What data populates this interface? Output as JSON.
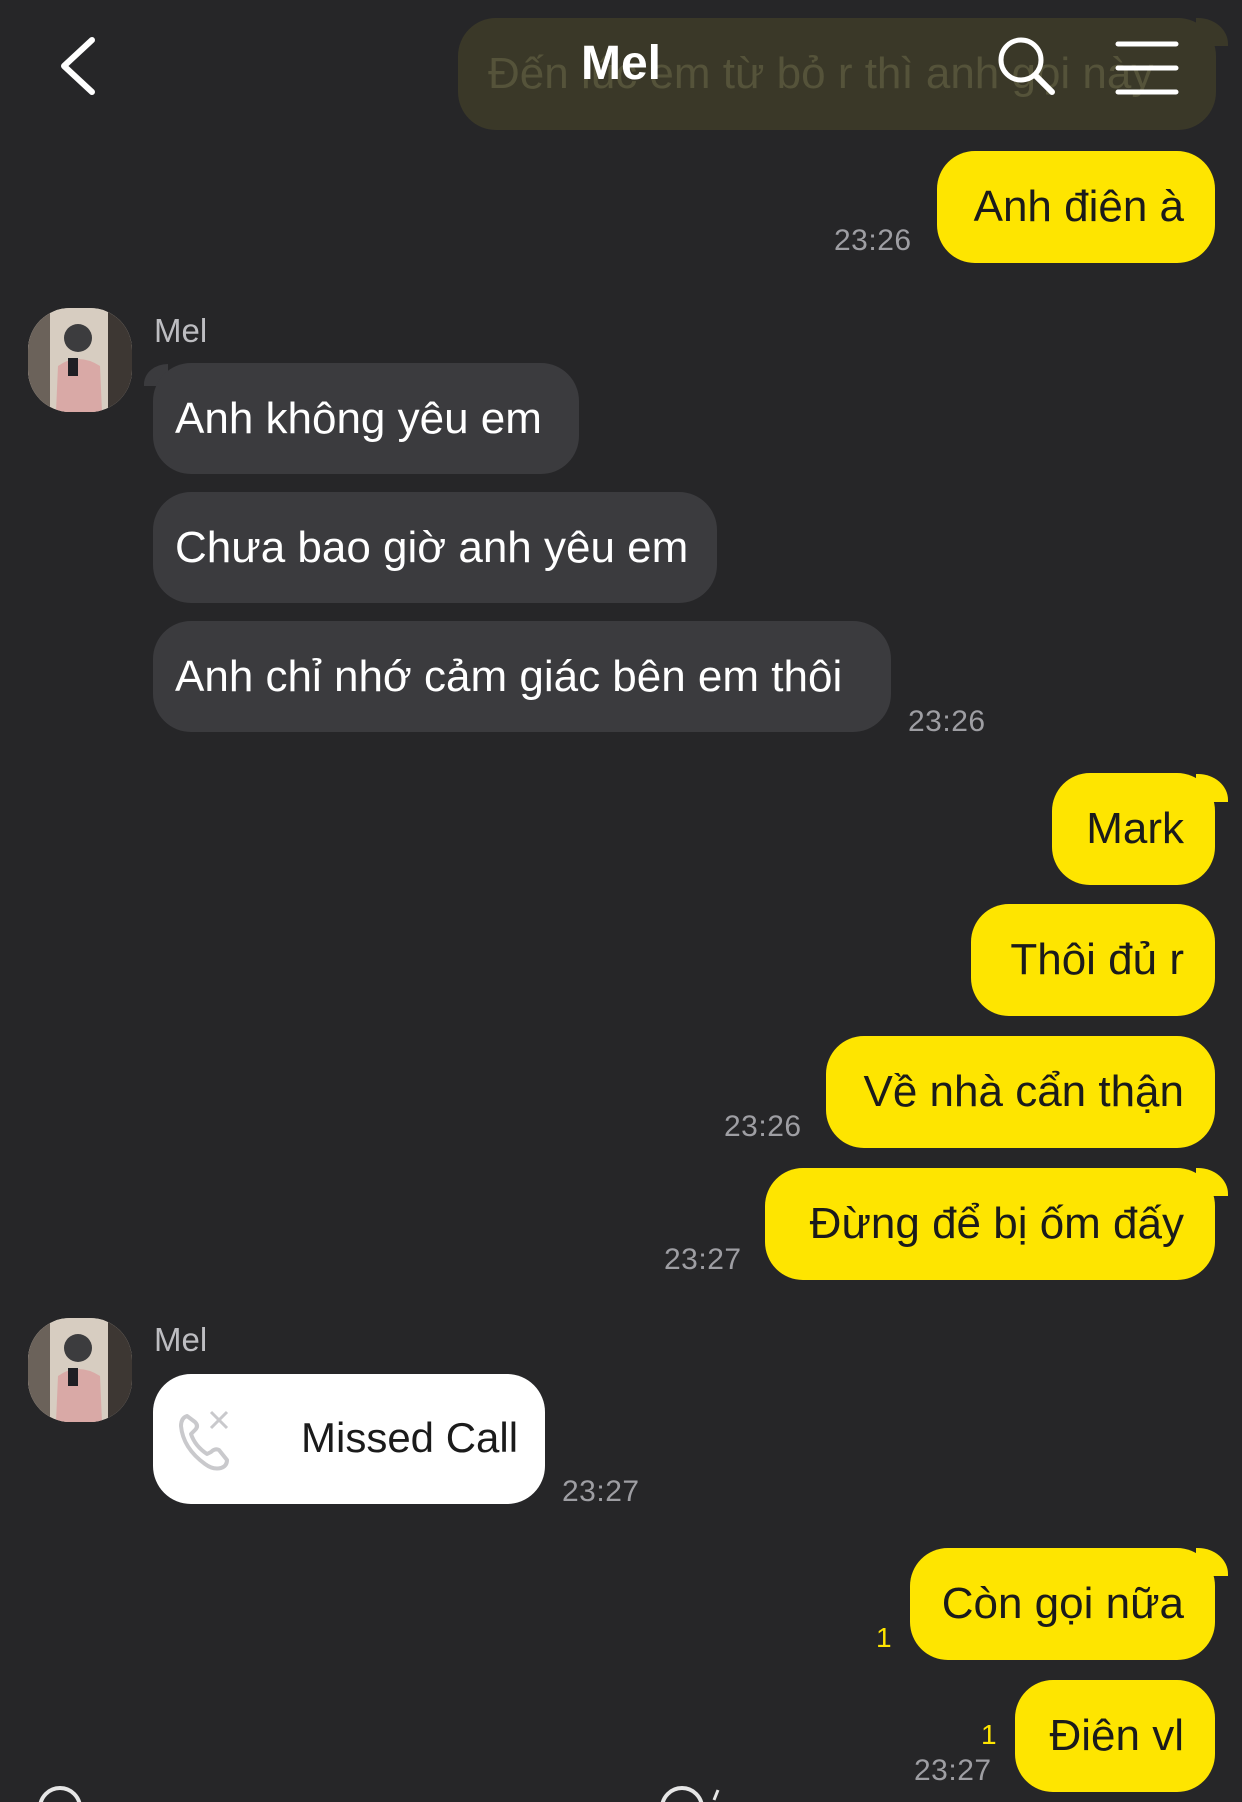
{
  "header": {
    "title": "Mel",
    "back_icon": "chevron-left-icon",
    "search_icon": "search-icon",
    "menu_icon": "hamburger-menu-icon"
  },
  "colors": {
    "background": "#262628",
    "my_bubble": "#FEE500",
    "their_bubble": "#3b3b3e",
    "unread": "#FEE500"
  },
  "messages": {
    "partial_top": "Đến lúc em từ bỏ r thì anh gọi này",
    "m1": {
      "text": "Anh điên à",
      "time": "23:26"
    },
    "g1": {
      "sender": "Mel",
      "m1": "Anh không yêu em",
      "m2": "Chưa bao giờ anh yêu em",
      "m3": "Anh chỉ nhớ cảm giác bên em thôi",
      "time": "23:26"
    },
    "g2": {
      "m1": "Mark",
      "m2": "Thôi đủ r",
      "m3": "Về nhà cẩn thận",
      "time": "23:26"
    },
    "g3": {
      "m1": "Đừng để bị ốm đấy",
      "time": "23:27"
    },
    "call": {
      "sender": "Mel",
      "label": "Missed Call",
      "icon": "missed-call-icon",
      "time": "23:27"
    },
    "g4": {
      "m1": "Còn gọi nữa",
      "unread": "1"
    },
    "g5": {
      "m1": "Điên vl",
      "unread": "1",
      "time": "23:27"
    }
  }
}
